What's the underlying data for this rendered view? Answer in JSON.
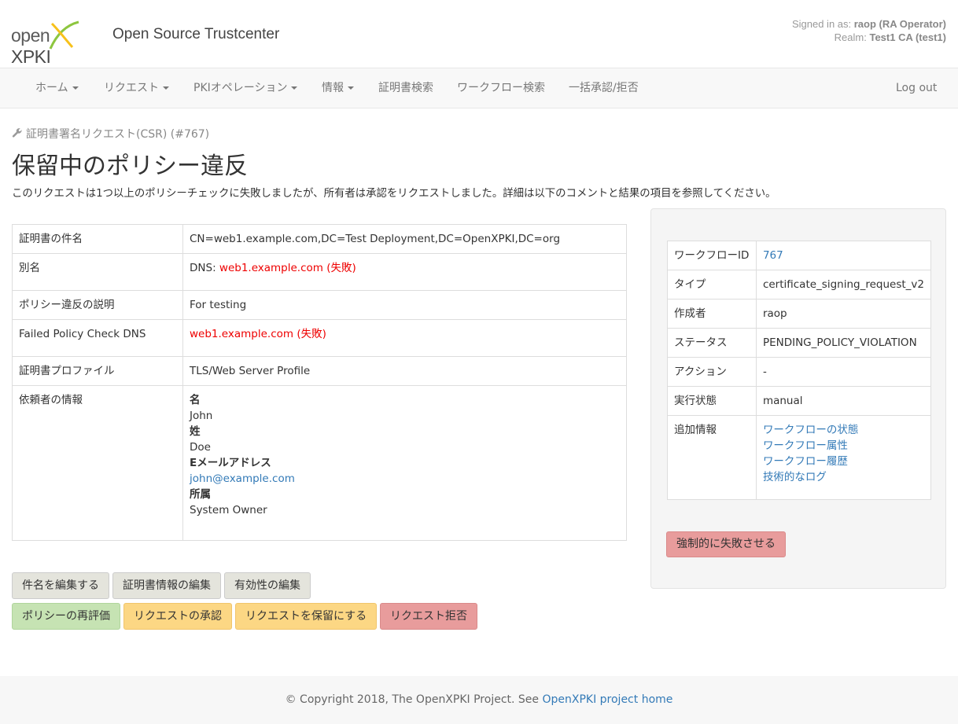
{
  "header": {
    "logo_open": "open",
    "logo_xpki": "XPKI",
    "site_title": "Open Source Trustcenter",
    "signed_label": "Signed in as: ",
    "signed_user": "raop (RA Operator)",
    "realm_label": "Realm: ",
    "realm_value": "Test1 CA (test1)"
  },
  "nav": {
    "items": [
      "ホーム",
      "リクエスト",
      "PKIオペレーション",
      "情報",
      "証明書検索",
      "ワークフロー検索",
      "一括承認/拒否"
    ],
    "logout": "Log out"
  },
  "page": {
    "breadcrumb": "証明書署名リクエスト(CSR) (#767)",
    "title": "保留中のポリシー違反",
    "description": "このリクエストは1つ以上のポリシーチェックに失敗しましたが、所有者は承認をリクエストしました。詳細は以下のコメントと結果の項目を参照してください。"
  },
  "details": {
    "subject_label": "証明書の件名",
    "subject_value": "CN=web1.example.com,DC=Test Deployment,DC=OpenXPKI,DC=org",
    "san_label": "別名",
    "san_prefix": "DNS: ",
    "san_value": "web1.example.com (失敗)",
    "violation_label": "ポリシー違反の説明",
    "violation_value": "For testing",
    "failed_dns_label": "Failed Policy Check DNS",
    "failed_dns_value": "web1.example.com (失敗)",
    "profile_label": "証明書プロファイル",
    "profile_value": "TLS/Web Server Profile",
    "requester_label": "依頼者の情報",
    "requester": {
      "first_name_label": "名",
      "first_name": "John",
      "last_name_label": "姓",
      "last_name": "Doe",
      "email_label": "Eメールアドレス",
      "email": "john@example.com",
      "org_label": "所属",
      "org": "System Owner"
    }
  },
  "workflow": {
    "id_label": "ワークフローID",
    "id_value": "767",
    "type_label": "タイプ",
    "type_value": "certificate_signing_request_v2",
    "creator_label": "作成者",
    "creator_value": "raop",
    "status_label": "ステータス",
    "status_value": "PENDING_POLICY_VIOLATION",
    "action_label": "アクション",
    "action_value": "-",
    "proc_label": "実行状態",
    "proc_value": "manual",
    "info_label": "追加情報",
    "info_links": [
      "ワークフローの状態",
      "ワークフロー属性",
      "ワークフロー履歴",
      "技術的なログ"
    ],
    "force_fail": "強制的に失敗させる"
  },
  "buttons": {
    "edit_subject": "件名を編集する",
    "edit_cert_info": "証明書情報の編集",
    "edit_validity": "有効性の編集",
    "reevaluate": "ポリシーの再評価",
    "approve": "リクエストの承認",
    "hold": "リクエストを保留にする",
    "reject": "リクエスト拒否"
  },
  "footer": {
    "text": "© Copyright 2018, The OpenXPKI Project. See ",
    "link": "OpenXPKI project home"
  },
  "colors": {
    "link": "#337ab7",
    "error": "#e00000",
    "success_btn": "#c6e3b3",
    "warning_btn": "#fcd784",
    "danger_btn": "#e89c9c"
  }
}
